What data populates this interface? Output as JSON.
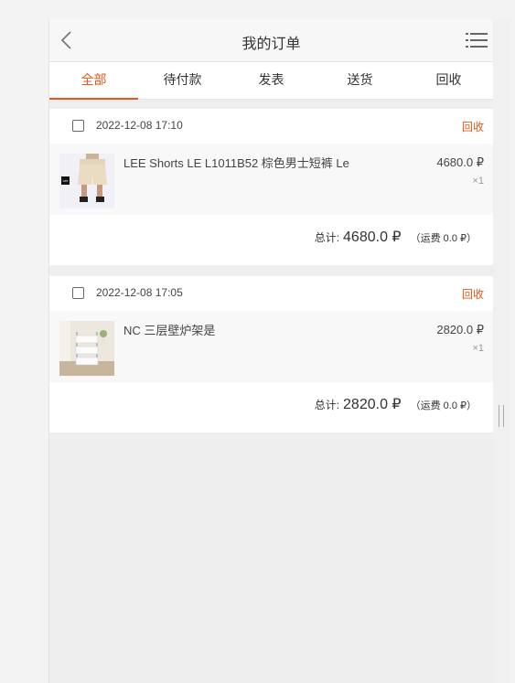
{
  "header": {
    "title": "我的订单",
    "back_icon": "chevron-left-icon",
    "menu_icon": "list-icon"
  },
  "tabs": [
    {
      "label": "全部",
      "active": true
    },
    {
      "label": "待付款",
      "active": false
    },
    {
      "label": "发表",
      "active": false
    },
    {
      "label": "送货",
      "active": false
    },
    {
      "label": "回收",
      "active": false
    }
  ],
  "orders": [
    {
      "time": "2022-12-08 17:10",
      "status": "回收",
      "item": {
        "name": "LEE Shorts LE L1011B52 棕色男士短裤 Le",
        "price": "4680.0 ₽",
        "qty": "×1",
        "logo": "Lee"
      },
      "total_label": "总计:",
      "total_amount": "4680.0 ₽",
      "shipping": "（运费 0.0 ₽）"
    },
    {
      "time": "2022-12-08 17:05",
      "status": "回收",
      "item": {
        "name": "NC 三层壁炉架是",
        "price": "2820.0 ₽",
        "qty": "×1"
      },
      "total_label": "总计:",
      "total_amount": "2820.0 ₽",
      "shipping": "（运费 0.0 ₽）"
    }
  ],
  "colors": {
    "accent": "#e8561b",
    "background": "#eeeeee"
  }
}
